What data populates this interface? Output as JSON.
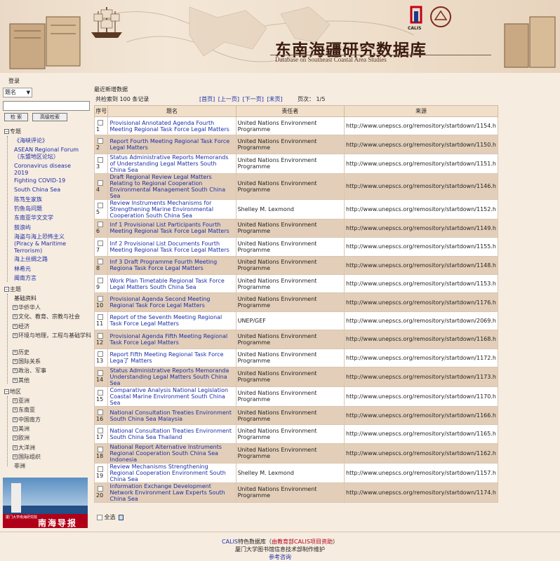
{
  "banner": {
    "title": "东南海疆研究数据库",
    "subtitle": "Database on Southeast Coastal Area Studies",
    "calis_logo_text": "CALIS"
  },
  "sidebar": {
    "login_label": "登录",
    "field_select_value": "题名",
    "search_button": "检 索",
    "advanced_button": "高级检索",
    "groups": [
      {
        "label": "专题",
        "items": [
          "《海峡评论》",
          "ASEAN Regional Forum（东盟地区论坛）",
          "Coronavirus disease 2019",
          "Fighting COVID-19",
          "South China Sea",
          "陈笃生家族",
          "钓鱼岛问题",
          "东南亚华文文学",
          "鼓浪屿",
          "海盗与海上恐怖主义 (Piracy & Maritime Terrorism)",
          "海上丝绸之路",
          "林希元",
          "闽南方言"
        ]
      },
      {
        "label": "主题",
        "items": [
          "基础资料",
          "华侨华人",
          "文化、教育、宗教与社会",
          "经济",
          "环境与地理，工程与基础学科",
          "历史",
          "国际关系",
          "政治、军事",
          "其他"
        ]
      },
      {
        "label": "地区",
        "items": [
          "亚洲",
          "东南亚",
          "中国南方",
          "美洲",
          "欧洲",
          "大洋洲",
          "国际组织",
          "非洲"
        ]
      }
    ],
    "promo": {
      "small_text": "厦门大学南海研究院",
      "big_text": "南海导报"
    }
  },
  "main": {
    "section_title": "最近新增数据",
    "total_text": "共检索到 100 条记录",
    "pager": {
      "first": "[首页]",
      "prev": "[上一页]",
      "next": "[下一页]",
      "last": "[末页]"
    },
    "page_info": "页次： 1/5",
    "columns": [
      "序号",
      "题名",
      "责任者",
      "来源"
    ],
    "rows": [
      {
        "no": "1",
        "title": "Provisional Annotated Agenda Fourth Meeting Regional Task Force Legal Matters",
        "resp": "United Nations Environment Programme",
        "src": "http://www.unepscs.org/remository/startdown/1154.h"
      },
      {
        "no": "2",
        "title": "Report Fourth Meeting Regional Task Force Legal Matters",
        "resp": "United Nations Environment Programme",
        "src": "http://www.unepscs.org/remository/startdown/1150.h"
      },
      {
        "no": "3",
        "title": "Status Administrative Reports Memorands of Understanding Legal Matters South China Sea",
        "resp": "United Nations Environment Programme",
        "src": "http://www.unepscs.org/remository/startdown/1151.h"
      },
      {
        "no": "4",
        "title": "Draft Regional Review Legal Matters Relating to Regional Cooperation Environmental Management South China Sea",
        "resp": "United Nations Environment Programme",
        "src": "http://www.unepscs.org/remository/startdown/1146.h"
      },
      {
        "no": "5",
        "title": "Review Instruments Mechanisms for Strengthening Marine Environmental Cooperation South China Sea",
        "resp": "Shelley M. Lexmond",
        "src": "http://www.unepscs.org/remository/startdown/1152.h"
      },
      {
        "no": "6",
        "title": "Inf 1 Provisional List Participants Fourth Meeting Regional Task Force Legal Matters",
        "resp": "United Nations Environment Programme",
        "src": "http://www.unepscs.org/remository/startdown/1149.h"
      },
      {
        "no": "7",
        "title": "Inf 2 Provisional List Documents Fourth Meeting Regional Task Force Legal Matters",
        "resp": "United Nations Environment Programme",
        "src": "http://www.unepscs.org/remository/startdown/1155.h"
      },
      {
        "no": "8",
        "title": "Inf 3 Draft Programme Fourth Meeting Regiona Task Force Legal Matters",
        "resp": "United Nations Environment Programme",
        "src": "http://www.unepscs.org/remository/startdown/1148.h"
      },
      {
        "no": "9",
        "title": "Work Plan Timetable Regional Task Force Legal Matters South China Sea",
        "resp": "United Nations Environment Programme",
        "src": "http://www.unepscs.org/remository/startdown/1153.h"
      },
      {
        "no": "10",
        "title": "Provisional Agenda Second Meeting Regional Task Force Legal Matters",
        "resp": "United Nations Environment Programme",
        "src": "http://www.unepscs.org/remository/startdown/1176.h"
      },
      {
        "no": "11",
        "title": "Report of the Seventh Meeting Regional Task Force Legal Matters",
        "resp": "UNEP/GEF",
        "src": "http://www.unepscs.org/remository/startdown/2069.h"
      },
      {
        "no": "12",
        "title": "Provisional Agenda Fifth Meeting Regional Task Force Legal Matters",
        "resp": "United Nations Environment Programme",
        "src": "http://www.unepscs.org/remository/startdown/1168.h"
      },
      {
        "no": "13",
        "title": "Report Fifth Meeting Regional Task Force Lega了 Matters",
        "resp": "United Nations Environment Programme",
        "src": "http://www.unepscs.org/remository/startdown/1172.h"
      },
      {
        "no": "14",
        "title": "Status Administrative Reports Memoranda Understanding Legal Matters South China Sea",
        "resp": "United Nations Environment Programme",
        "src": "http://www.unepscs.org/remository/startdown/1173.h"
      },
      {
        "no": "15",
        "title": "Comparative Analysis National Legislation Coastal Marine Environment South China Sea",
        "resp": "United Nations Environment Programme",
        "src": "http://www.unepscs.org/remository/startdown/1170.h"
      },
      {
        "no": "16",
        "title": "National Consultation Treaties Environment South China Sea Malaysia",
        "resp": "United Nations Environment Programme",
        "src": "http://www.unepscs.org/remository/startdown/1166.h"
      },
      {
        "no": "17",
        "title": "National Consultation Treaties Environment South China Sea Thailand",
        "resp": "United Nations Environment Programme",
        "src": "http://www.unepscs.org/remository/startdown/1165.h"
      },
      {
        "no": "18",
        "title": "National Report Alternative Instruments Regional Cooperation South China Sea Indonesia",
        "resp": "United Nations Environment Programme",
        "src": "http://www.unepscs.org/remository/startdown/1162.h"
      },
      {
        "no": "19",
        "title": "Review Mechanisms Strengthening Regional Cooperation Environment South China Sea",
        "resp": "Shelley M. Lexmond",
        "src": "http://www.unepscs.org/remository/startdown/1157.h"
      },
      {
        "no": "20",
        "title": "Information Exchange Development Network Environment Law Experts South China Sea",
        "resp": "United Nations Environment Programme",
        "src": "http://www.unepscs.org/remository/startdown/1174.h"
      }
    ],
    "select_all_label": "全选"
  },
  "footer": {
    "calis": "CALIS",
    "line1_mid": "特色数据库（",
    "line1_red": "由教育部CALIS项目资助",
    "line1_end": "）",
    "line2": "厦门大学图书馆信息技术部制作维护",
    "line3": "参考咨询"
  }
}
